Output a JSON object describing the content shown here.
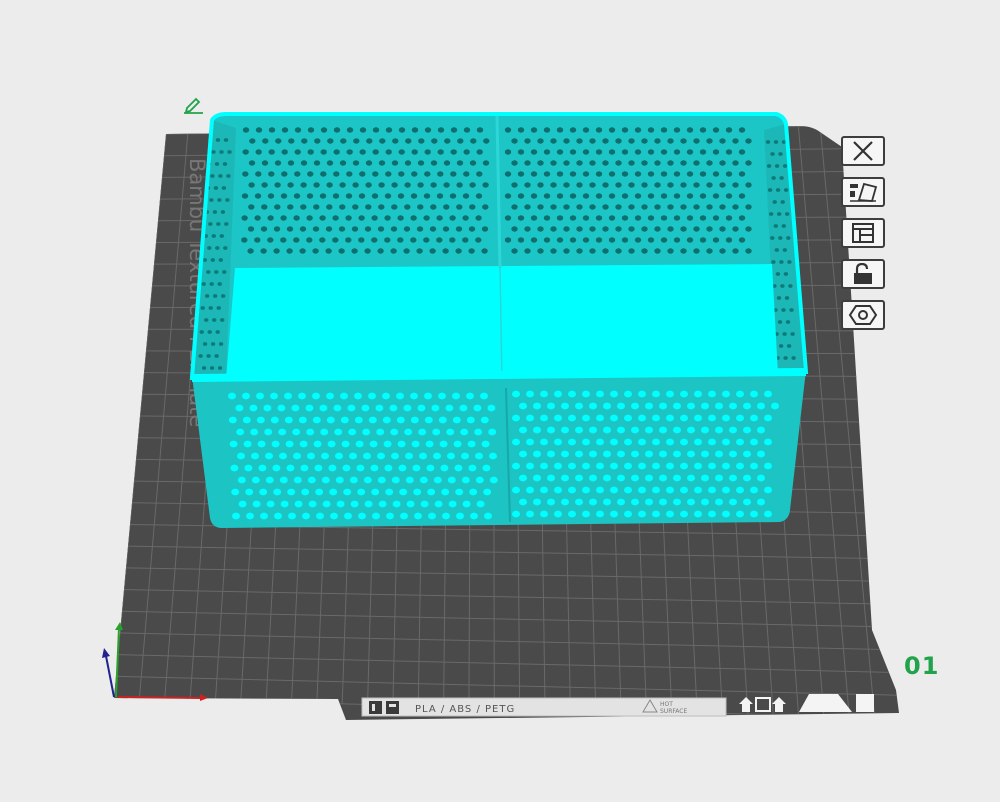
{
  "plate": {
    "number": "01",
    "brand_text": "Bambu Textured PEI Plate",
    "material_text": "PLA / ABS / PETG",
    "hot_line1": "HOT",
    "hot_line2": "SURFACE",
    "colors": {
      "plate": "#4a4a4a",
      "grid": "#6a6a6a",
      "model": "#00ffff",
      "model_shade": "#18b3b3",
      "label_green": "#22a24a"
    }
  },
  "toolbar": {
    "buttons": [
      {
        "name": "close-plate-button",
        "icon": "close-icon"
      },
      {
        "name": "arrange-button",
        "icon": "arrange-icon"
      },
      {
        "name": "plate-settings-button",
        "icon": "layout-icon"
      },
      {
        "name": "lock-plate-button",
        "icon": "lock-open-icon"
      },
      {
        "name": "plate-type-button",
        "icon": "hexagon-nut-icon"
      }
    ]
  }
}
